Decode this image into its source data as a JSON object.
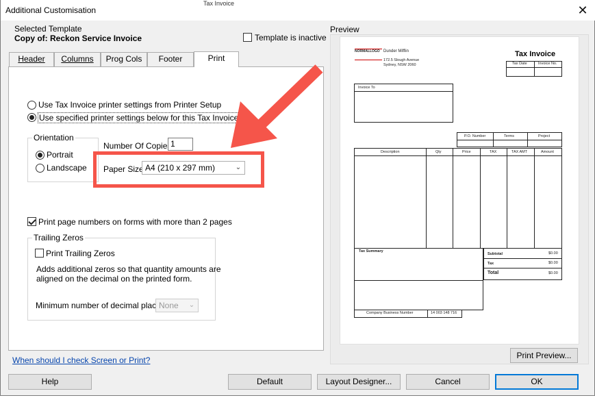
{
  "window": {
    "title": "Additional Customisation",
    "close": "✕"
  },
  "selected_template": {
    "label": "Selected Template",
    "name": "Copy of: Reckon Service Invoice",
    "inactive_label": "Template is inactive"
  },
  "tabs": [
    {
      "label": "Header"
    },
    {
      "label": "Columns"
    },
    {
      "label": "Prog Cols"
    },
    {
      "label": "Footer"
    },
    {
      "label": "Print"
    }
  ],
  "print": {
    "option_printer_setup": "Use Tax Invoice printer settings from Printer Setup",
    "option_specified": "Use specified printer settings below for this Tax Invoice",
    "orientation_label": "Orientation",
    "portrait": "Portrait",
    "landscape": "Landscape",
    "copies_label": "Number Of Copies",
    "copies_value": "1",
    "paper_size_label": "Paper Size",
    "paper_size_value": "A4 (210 x 297 mm)",
    "page_numbers_label": "Print page numbers on forms with more than 2 pages",
    "trailing_zeros_label": "Trailing Zeros",
    "print_trailing_zeros": "Print Trailing Zeros",
    "trailing_desc_1": "Adds additional zeros so that quantity amounts are",
    "trailing_desc_2": "aligned on the decimal on the printed form.",
    "min_decimal_label": "Minimum number of decimal places:",
    "min_decimal_value": "None"
  },
  "help_link": "When should I check Screen or Print?",
  "preview": {
    "label": "Preview",
    "logo_text": "NORMALLOGO",
    "company_name": "Dunder Mifflin",
    "address_1": "172.5 Slough Avenue",
    "address_2": "Sydney, NSW 2060",
    "doc_title": "Tax Invoice",
    "tax_date": "Tax Date",
    "invoice_no": "Invoice No.",
    "invoice_to": "Invoice To",
    "po_number": "P.O. Number",
    "terms": "Terms",
    "project": "Project",
    "columns": [
      "Description",
      "Qty",
      "Price",
      "TAX",
      "TAX AMT",
      "Amount"
    ],
    "tax_summary": "Tax Summary",
    "subtotal": "Subtotal",
    "tax": "Tax",
    "total": "Total",
    "zero": "$0.00",
    "abn_label": "Company Business Number",
    "abn_value": "14 003 148 716",
    "print_preview_btn": "Print Preview..."
  },
  "buttons": {
    "help": "Help",
    "default": "Default",
    "layout_designer": "Layout Designer...",
    "cancel": "Cancel",
    "ok": "OK"
  },
  "background": {
    "text": "Tax Invoice"
  },
  "colors": {
    "annotation_red": "#f5554a",
    "focus_blue": "#0078d7",
    "link_blue": "#0645ad"
  }
}
